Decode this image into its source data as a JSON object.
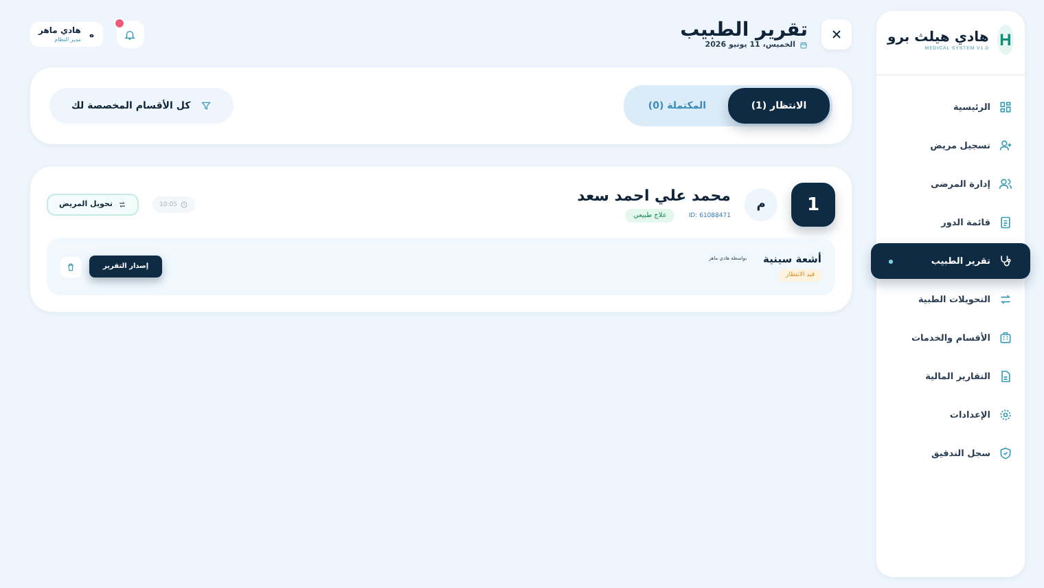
{
  "sidebar": {
    "logo_letter": "H",
    "brand": "هادي هيلث برو",
    "tagline": "MEDICAL SYSTEM V1.0",
    "items": [
      {
        "label": "الرئيسية",
        "selected": false
      },
      {
        "label": "تسجيل مريض",
        "selected": false
      },
      {
        "label": "إدارة المرضى",
        "selected": false
      },
      {
        "label": "قائمة الدور",
        "selected": false
      },
      {
        "label": "تقرير الطبيب",
        "selected": true
      },
      {
        "label": "التحويلات الطبية",
        "selected": false
      },
      {
        "label": "الأقسام والخدمات",
        "selected": false
      },
      {
        "label": "التقارير المالية",
        "selected": false
      },
      {
        "label": "الإعدادات",
        "selected": false
      },
      {
        "label": "سجل التدقيق",
        "selected": false
      }
    ]
  },
  "header": {
    "title": "تقرير الطبيب",
    "date": "الخميس، 11 يونيو 2026",
    "notification": true,
    "user": {
      "name": "هادي ماهر",
      "role": "مدير النظام",
      "initial": "ه"
    }
  },
  "tabs": [
    {
      "label": "الانتظار (1)",
      "selected": true
    },
    {
      "label": "المكتملة (0)",
      "selected": false
    }
  ],
  "filter": {
    "label": "كل الأقسام المخصصة لك"
  },
  "patients": [
    {
      "number": "1",
      "initial": "م",
      "name": "محمد علي احمد سعد",
      "id": "ID: 61088471",
      "department": "علاج طبيعي",
      "time": "10:05",
      "transfer": "تحويل المريض",
      "orders": [
        {
          "name": "أشعة سينية",
          "by": "بواسطة هادي ماهر",
          "status": "قيد الانتظار",
          "action": "إصدار التقرير"
        }
      ]
    }
  ]
}
